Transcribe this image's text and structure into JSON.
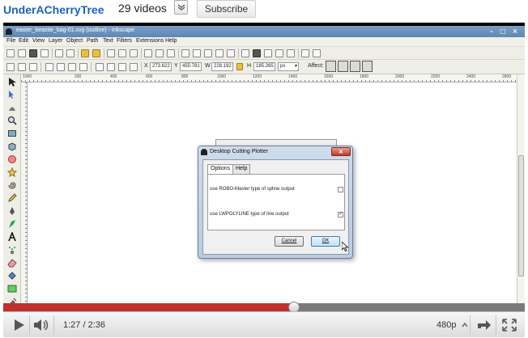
{
  "channel": {
    "name": "UnderACherryTree",
    "video_count": "29 videos",
    "subscribe_label": "Subscribe"
  },
  "app": {
    "window_title": "easter_beastie_bag-01.svg (outline) - Inkscape",
    "menu": [
      "File",
      "Edit",
      "View",
      "Layer",
      "Object",
      "Path",
      "Text",
      "Filters",
      "Extensions",
      "Help"
    ],
    "coords": {
      "x_label": "X",
      "x_value": "273.622",
      "y_label": "Y",
      "y_value": "455.781",
      "w_label": "W",
      "w_value": "228.192",
      "h_label": "H",
      "h_value": "185.265",
      "unit": "px"
    },
    "affect_label": "Affect:",
    "ruler_numbers": [
      "1000",
      "200",
      "300",
      "400",
      "500",
      "600",
      "700",
      "800",
      "900",
      "1000",
      "1100",
      "1200",
      "1300",
      "1400",
      "1500",
      "1600",
      "1700",
      "1800",
      "1900",
      "2000",
      "2100",
      "2200",
      "2300",
      "2400",
      "2500",
      "2600",
      "2700",
      "2800"
    ]
  },
  "dialog": {
    "title": "Desktop Cutting Plotter",
    "tabs": [
      "Options",
      "Help"
    ],
    "option1_label": "use ROBO-Master type of spline output",
    "option1_checked": false,
    "option2_label": "use LWPOLYLINE type of line output",
    "option2_checked": true,
    "cancel_label": "Cancel",
    "ok_label": "OK"
  },
  "player": {
    "current_time": "1:27 / 2:36",
    "progress_fraction": 0.557,
    "buffered_fraction": 1.0,
    "quality": "480p",
    "colors": {
      "played": "#c0302c",
      "channel_link": "#1c62b9"
    }
  }
}
